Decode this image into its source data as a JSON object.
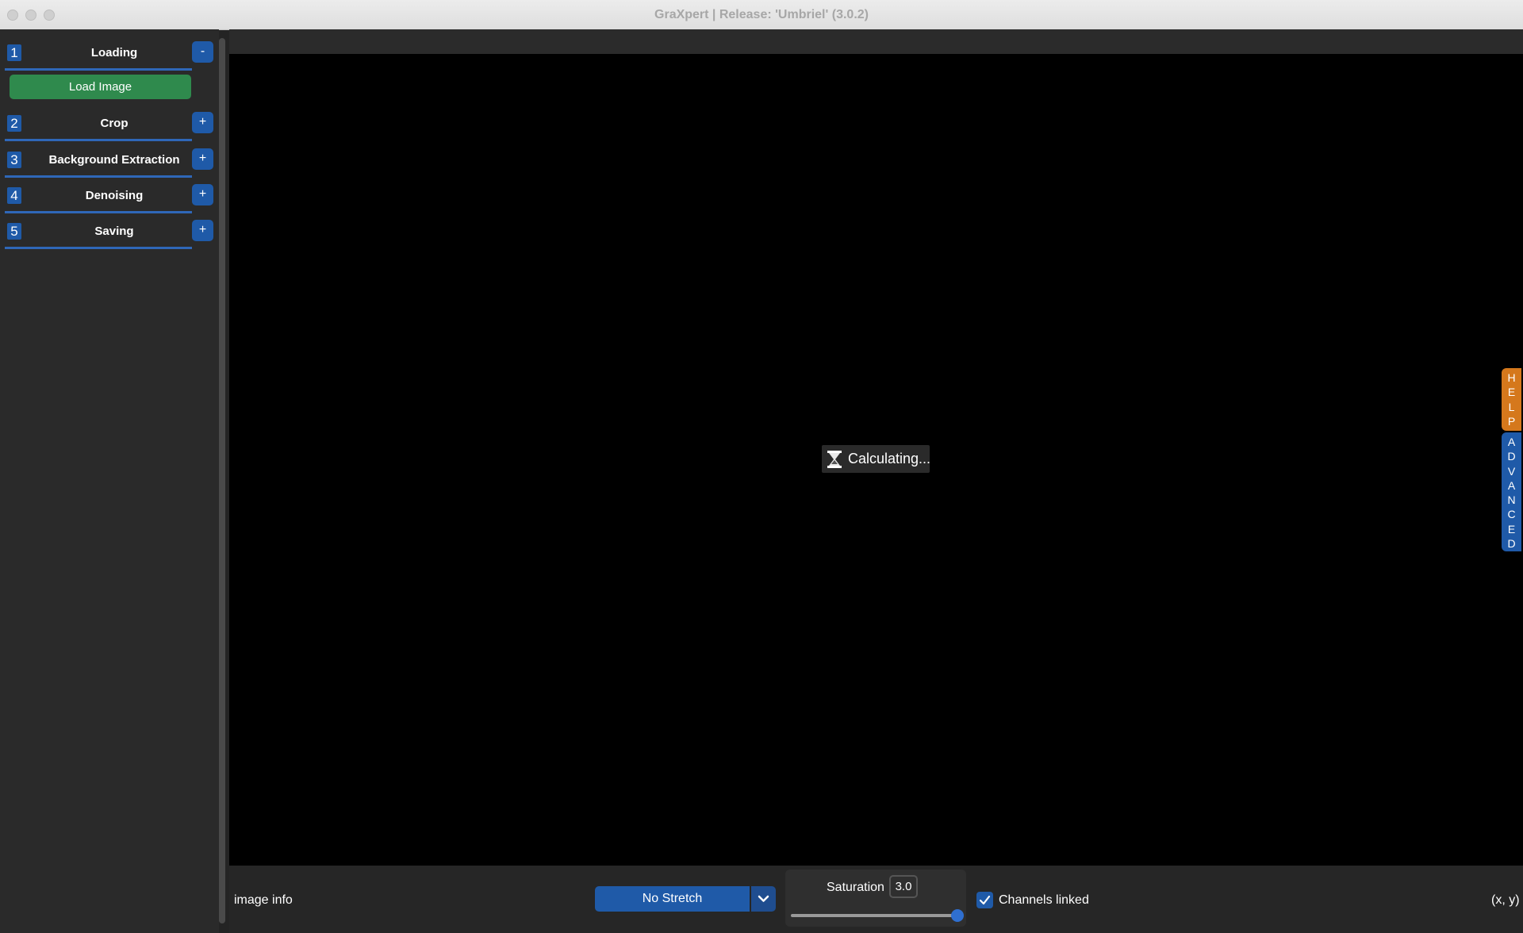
{
  "window": {
    "title": "GraXpert | Release: 'Umbriel' (3.0.2)"
  },
  "sidebar": {
    "sections": [
      {
        "num": "1",
        "label": "Loading",
        "toggle": "-"
      },
      {
        "num": "2",
        "label": "Crop",
        "toggle": "+"
      },
      {
        "num": "3",
        "label": "Background Extraction",
        "toggle": "+"
      },
      {
        "num": "4",
        "label": "Denoising",
        "toggle": "+"
      },
      {
        "num": "5",
        "label": "Saving",
        "toggle": "+"
      }
    ],
    "load_button": "Load Image"
  },
  "canvas": {
    "status": "Calculating..."
  },
  "side_tabs": {
    "help": "HELP",
    "advanced": "ADVANCED"
  },
  "bottom": {
    "image_info": "image info",
    "stretch": "No Stretch",
    "saturation_label": "Saturation",
    "saturation_value": "3.0",
    "saturation_slider": 1.0,
    "channels_linked_label": "Channels linked",
    "channels_linked": true,
    "coords": "(x, y)"
  },
  "colors": {
    "accent": "#1f5aa8",
    "load_button": "#2f8a4d",
    "help_tab": "#d5781c"
  }
}
